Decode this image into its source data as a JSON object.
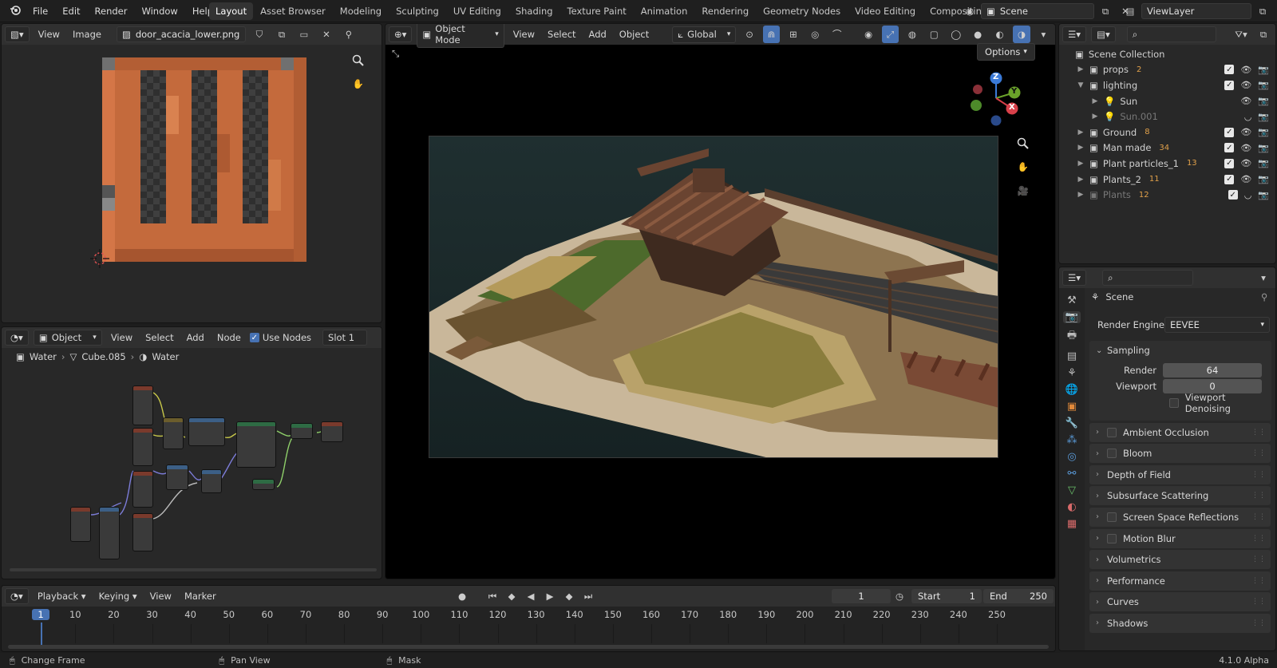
{
  "topbar": {
    "menus": [
      "File",
      "Edit",
      "Render",
      "Window",
      "Help"
    ],
    "workspaces": [
      "Layout",
      "Asset Browser",
      "Modeling",
      "Sculpting",
      "UV Editing",
      "Shading",
      "Texture Paint",
      "Animation",
      "Rendering",
      "Geometry Nodes",
      "Video Editing",
      "Compositin"
    ],
    "active_workspace": "Layout",
    "scene": "Scene",
    "view_layer": "ViewLayer"
  },
  "image_editor": {
    "menus": [
      "View",
      "Image"
    ],
    "image_name": "door_acacia_lower.png"
  },
  "viewport": {
    "mode": "Object Mode",
    "menus": [
      "View",
      "Select",
      "Add",
      "Object"
    ],
    "orientation": "Global",
    "options_label": "Options",
    "gizmo": {
      "z": "Z",
      "y": "Y",
      "x": "X"
    }
  },
  "node_editor": {
    "type": "Object",
    "menus": [
      "View",
      "Select",
      "Add",
      "Node"
    ],
    "use_nodes_label": "Use Nodes",
    "slot": "Slot 1",
    "breadcrumb": [
      "Water",
      "Cube.085",
      "Water"
    ]
  },
  "outliner": {
    "root": "Scene Collection",
    "items": [
      {
        "label": "props",
        "count": "2",
        "level": 1,
        "open": false,
        "dim": false
      },
      {
        "label": "lighting",
        "count": "",
        "level": 1,
        "open": true,
        "dim": false
      },
      {
        "label": "Sun",
        "count": "",
        "level": 2,
        "open": false,
        "dim": false
      },
      {
        "label": "Sun.001",
        "count": "",
        "level": 2,
        "open": false,
        "dim": true
      },
      {
        "label": "Ground",
        "count": "8",
        "level": 1,
        "open": false,
        "dim": false
      },
      {
        "label": "Man made",
        "count": "34",
        "level": 1,
        "open": false,
        "dim": false
      },
      {
        "label": "Plant particles_1",
        "count": "13",
        "level": 1,
        "open": false,
        "dim": false
      },
      {
        "label": "Plants_2",
        "count": "11",
        "level": 1,
        "open": false,
        "dim": false
      },
      {
        "label": "Plants",
        "count": "12",
        "level": 1,
        "open": false,
        "dim": true
      }
    ]
  },
  "properties": {
    "context": "Scene",
    "render_engine_label": "Render Engine",
    "render_engine": "EEVEE",
    "sampling": {
      "title": "Sampling",
      "render_label": "Render",
      "render": "64",
      "viewport_label": "Viewport",
      "viewport": "0",
      "denoise_label": "Viewport Denoising"
    },
    "sections": [
      "Ambient Occlusion",
      "Bloom",
      "Depth of Field",
      "Subsurface Scattering",
      "Screen Space Reflections",
      "Motion Blur",
      "Volumetrics",
      "Performance",
      "Curves",
      "Shadows"
    ],
    "sections_with_checkbox": [
      "Ambient Occlusion",
      "Bloom",
      "Screen Space Reflections",
      "Motion Blur"
    ]
  },
  "timeline": {
    "menus": [
      "Playback",
      "Keying",
      "View",
      "Marker"
    ],
    "current_frame": "1",
    "start_label": "Start",
    "start": "1",
    "end_label": "End",
    "end": "250",
    "ticks": [
      "1",
      "10",
      "20",
      "30",
      "40",
      "50",
      "60",
      "70",
      "80",
      "90",
      "100",
      "110",
      "120",
      "130",
      "140",
      "150",
      "160",
      "170",
      "180",
      "190",
      "200",
      "210",
      "220",
      "230",
      "240",
      "250"
    ]
  },
  "statusbar": {
    "items": [
      "Change Frame",
      "Pan View",
      "Mask"
    ],
    "version": "4.1.0 Alpha"
  },
  "colors": {
    "accent": "#4772b3",
    "bg": "#1d1d1d",
    "panel": "#282828"
  }
}
